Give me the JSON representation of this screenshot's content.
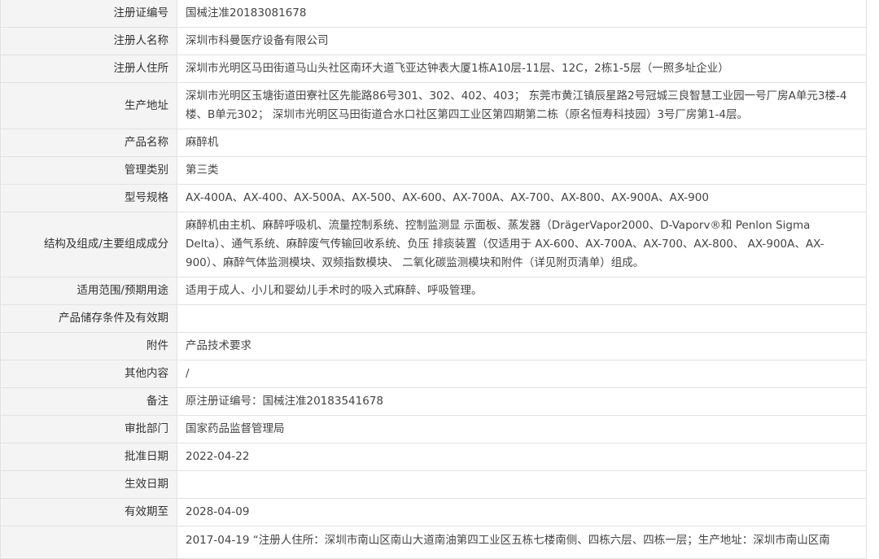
{
  "rows": [
    {
      "label": "注册证编号",
      "value": "国械注准20183081678"
    },
    {
      "label": "注册人名称",
      "value": "深圳市科曼医疗设备有限公司"
    },
    {
      "label": "注册人住所",
      "value": "深圳市光明区马田街道马山头社区南环大道飞亚达钟表大厦1栋A10层-11层、12C，2栋1-5层（一照多址企业）"
    },
    {
      "label": "生产地址",
      "value": "深圳市光明区玉塘街道田寮社区先能路86号301、302、402、403； 东莞市黄江镇辰星路2号冠城三良智慧工业园一号厂房A单元3楼-4楼、B单元302； 深圳市光明区马田街道合水口社区第四工业区第四期第二栋（原名恒寿科技园）3号厂房第1-4层。"
    },
    {
      "label": "产品名称",
      "value": "麻醉机"
    },
    {
      "label": "管理类别",
      "value": "第三类"
    },
    {
      "label": "型号规格",
      "value": "AX-400A、AX-400、AX-500A、AX-500、AX-600、AX-700A、AX-700、AX-800、AX-900A、AX-900"
    },
    {
      "label": "结构及组成/主要组成成分",
      "value": "麻醉机由主机、麻醉呼吸机、流量控制系统、控制监测显 示面板、蒸发器（DrägerVapor2000、D-Vaporv®和 Penlon Sigma Delta）、通气系统、麻醉废气传输回收系统、负压 排痰装置（仅适用于 AX-600、AX-700A、AX-700、AX-800、 AX-900A、AX-900）、麻醉气体监测模块、双频指数模块、 二氧化碳监测模块和附件（详见附页清单）组成。"
    },
    {
      "label": "适用范围/预期用途",
      "value": "适用于成人、小儿和婴幼儿手术时的吸入式麻醉、呼吸管理。"
    },
    {
      "label": "产品储存条件及有效期",
      "value": ""
    },
    {
      "label": "附件",
      "value": "产品技术要求"
    },
    {
      "label": "其他内容",
      "value": "/"
    },
    {
      "label": "备注",
      "value": "原注册证编号：国械注准20183541678"
    },
    {
      "label": "审批部门",
      "value": "国家药品监督管理局"
    },
    {
      "label": "批准日期",
      "value": "2022-04-22"
    },
    {
      "label": "生效日期",
      "value": ""
    },
    {
      "label": "有效期至",
      "value": "2028-04-09"
    },
    {
      "label": "",
      "value": "2017-04-19 “注册人住所：深圳市南山区南山大道南油第四工业区五栋七楼南侧、四栋六层、四栋一层；生产地址：深圳市南山区南"
    }
  ]
}
